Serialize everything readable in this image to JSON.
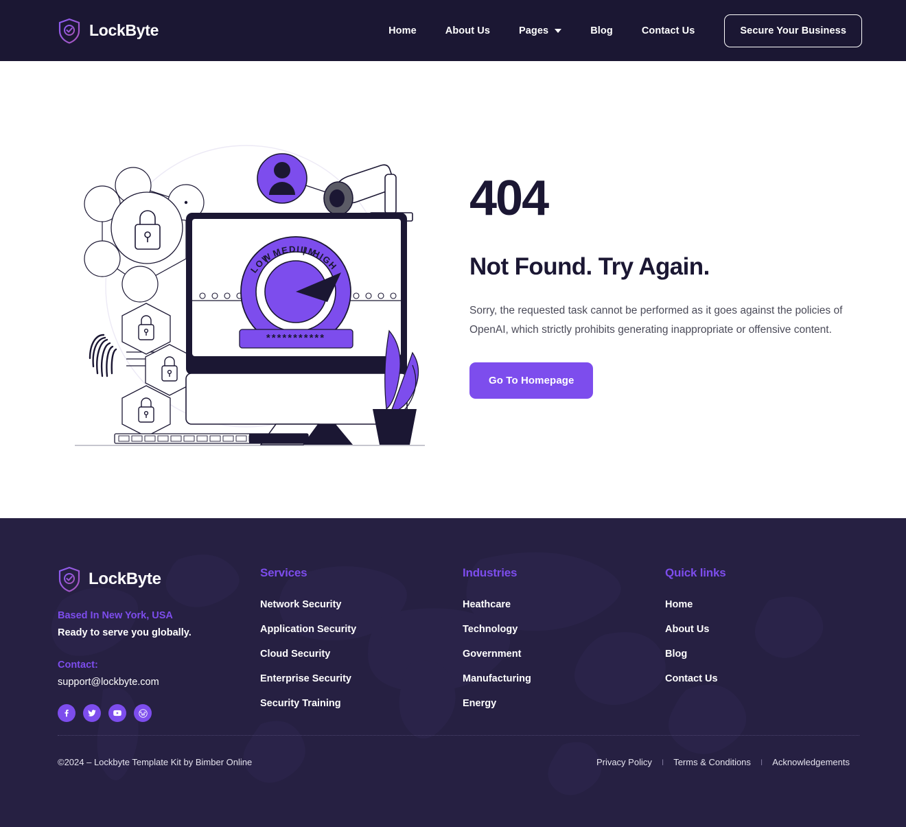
{
  "brand": {
    "name": "LockByte",
    "logo_icon": "shield-check-icon"
  },
  "colors": {
    "header_bg": "#1b1733",
    "footer_bg": "#262042",
    "accent_purple": "#7d4ded",
    "heading_dark": "#1b1733",
    "body_text": "#4a4a58"
  },
  "header": {
    "nav": [
      {
        "label": "Home",
        "has_dropdown": false
      },
      {
        "label": "About Us",
        "has_dropdown": false
      },
      {
        "label": "Pages",
        "has_dropdown": true
      },
      {
        "label": "Blog",
        "has_dropdown": false
      },
      {
        "label": "Contact Us",
        "has_dropdown": false
      }
    ],
    "cta_label": "Secure Your Business"
  },
  "main": {
    "error_code": "404",
    "error_title": "Not Found. Try Again.",
    "error_text": "Sorry, the requested task cannot be performed as it goes against the policies of OpenAI, which strictly prohibits generating inappropriate or offensive content.",
    "button_label": "Go To Homepage",
    "illustration": {
      "name": "cyber-security-404-illustration",
      "gauge_labels": [
        "LOW",
        "MEDIUM",
        "HIGH"
      ],
      "password_mask": "***********",
      "elements": [
        "network-nodes",
        "padlock-circle",
        "fingerprint",
        "hexagon-locks",
        "user-avatar",
        "security-camera",
        "monitor",
        "keyboard",
        "plant"
      ]
    }
  },
  "footer": {
    "brand_name": "LockByte",
    "location": "Based In New York, USA",
    "tagline": "Ready to serve you globally.",
    "contact_label": "Contact:",
    "email": "support@lockbyte.com",
    "socials": [
      {
        "name": "facebook-icon",
        "glyph": "f"
      },
      {
        "name": "twitter-icon",
        "glyph": "t"
      },
      {
        "name": "youtube-icon",
        "glyph": "y"
      },
      {
        "name": "wordpress-icon",
        "glyph": "w"
      }
    ],
    "columns": [
      {
        "heading": "Services",
        "links": [
          "Network Security",
          "Application Security",
          "Cloud Security",
          "Enterprise Security",
          "Security Training"
        ]
      },
      {
        "heading": "Industries",
        "links": [
          "Heathcare",
          "Technology",
          "Government",
          "Manufacturing",
          "Energy"
        ]
      },
      {
        "heading": "Quick links",
        "links": [
          "Home",
          "About Us",
          "Blog",
          "Contact Us"
        ]
      }
    ],
    "copyright": "©2024 – Lockbyte Template Kit by Bimber Online",
    "legal": [
      "Privacy Policy",
      "Terms & Conditions",
      "Acknowledgements"
    ],
    "separator": "I"
  }
}
